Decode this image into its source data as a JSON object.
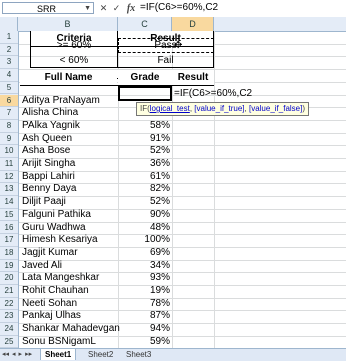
{
  "formula_bar": {
    "name_box": "SRR",
    "cancel": "✕",
    "enter": "✓",
    "fx": "fx",
    "formula": "=IF(C6>=60%,C2"
  },
  "columns": [
    "B",
    "C",
    "D"
  ],
  "rows": [
    "1",
    "2",
    "3",
    "4",
    "5",
    "6",
    "7",
    "8",
    "9",
    "10",
    "11",
    "12",
    "13",
    "14",
    "15",
    "16",
    "17",
    "18",
    "19",
    "20",
    "21",
    "22",
    "23",
    "24",
    "25"
  ],
  "criteria_table": {
    "header_criteria": "Criteria",
    "header_result": "Result",
    "row1_criteria": ">= 60%",
    "row1_result": "Pass",
    "row2_criteria": "< 60%",
    "row2_result": "Fail"
  },
  "main_table": {
    "header_name": "Full Name",
    "header_grade": "Grade",
    "header_result": "Result",
    "active_formula": "=IF(C6>=60%,C2",
    "students": [
      {
        "name": "Aditya PraNayam",
        "grade": ""
      },
      {
        "name": "Alisha China",
        "grade": ""
      },
      {
        "name": "PAlka Yagnik",
        "grade": "58%"
      },
      {
        "name": "Ash Queen",
        "grade": "91%"
      },
      {
        "name": "Asha Bose",
        "grade": "52%"
      },
      {
        "name": "Arijit Singha",
        "grade": "36%"
      },
      {
        "name": "Bappi Lahiri",
        "grade": "61%"
      },
      {
        "name": "Benny Daya",
        "grade": "82%"
      },
      {
        "name": "Diljit Paaji",
        "grade": "52%"
      },
      {
        "name": "Falguni Pathika",
        "grade": "90%"
      },
      {
        "name": "Guru Wadhwa",
        "grade": "48%"
      },
      {
        "name": "Himesh Kesariya",
        "grade": "100%"
      },
      {
        "name": "Jagjit Kumar",
        "grade": "69%"
      },
      {
        "name": "Javed Ali",
        "grade": "34%"
      },
      {
        "name": "Lata Mangeshkar",
        "grade": "93%"
      },
      {
        "name": "Rohit Chauhan",
        "grade": "19%"
      },
      {
        "name": "Neeti Sohan",
        "grade": "78%"
      },
      {
        "name": "Pankaj Ulhas",
        "grade": "87%"
      },
      {
        "name": "Shankar Mahadevgan",
        "grade": "94%"
      },
      {
        "name": "Sonu BSNigamL",
        "grade": "59%"
      }
    ]
  },
  "tooltip": {
    "fn": "IF(",
    "arg1": "logical_test",
    "sep1": ", ",
    "arg2": "[value_if_true]",
    "sep2": ", ",
    "arg3": "[value_if_false]",
    "close": ")"
  },
  "sheet_tabs": [
    "Sheet1",
    "Sheet2",
    "Sheet3"
  ],
  "tab_nav": [
    "◂◂",
    "◂",
    "▸",
    "▸▸"
  ]
}
